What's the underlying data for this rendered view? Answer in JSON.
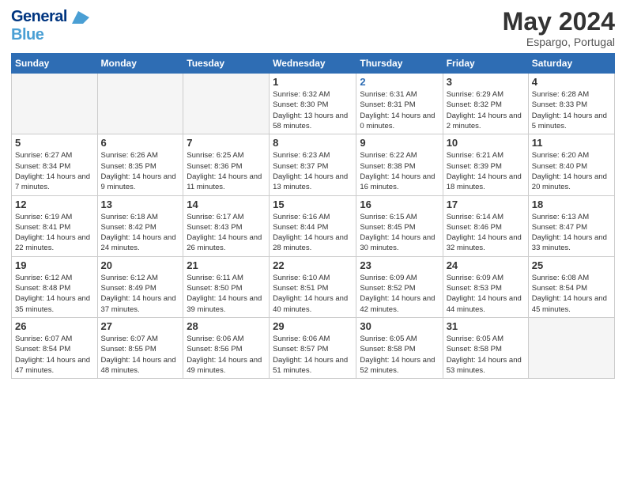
{
  "header": {
    "logo_line1": "General",
    "logo_line2": "Blue",
    "month": "May 2024",
    "location": "Espargo, Portugal"
  },
  "weekdays": [
    "Sunday",
    "Monday",
    "Tuesday",
    "Wednesday",
    "Thursday",
    "Friday",
    "Saturday"
  ],
  "weeks": [
    [
      {
        "day": "",
        "empty": true
      },
      {
        "day": "",
        "empty": true
      },
      {
        "day": "",
        "empty": true
      },
      {
        "day": "1",
        "sunrise": "6:32 AM",
        "sunset": "8:30 PM",
        "daylight": "13 hours and 58 minutes."
      },
      {
        "day": "2",
        "sunrise": "6:31 AM",
        "sunset": "8:31 PM",
        "daylight": "14 hours and 0 minutes.",
        "highlight": true
      },
      {
        "day": "3",
        "sunrise": "6:29 AM",
        "sunset": "8:32 PM",
        "daylight": "14 hours and 2 minutes."
      },
      {
        "day": "4",
        "sunrise": "6:28 AM",
        "sunset": "8:33 PM",
        "daylight": "14 hours and 5 minutes."
      }
    ],
    [
      {
        "day": "5",
        "sunrise": "6:27 AM",
        "sunset": "8:34 PM",
        "daylight": "14 hours and 7 minutes."
      },
      {
        "day": "6",
        "sunrise": "6:26 AM",
        "sunset": "8:35 PM",
        "daylight": "14 hours and 9 minutes."
      },
      {
        "day": "7",
        "sunrise": "6:25 AM",
        "sunset": "8:36 PM",
        "daylight": "14 hours and 11 minutes."
      },
      {
        "day": "8",
        "sunrise": "6:23 AM",
        "sunset": "8:37 PM",
        "daylight": "14 hours and 13 minutes."
      },
      {
        "day": "9",
        "sunrise": "6:22 AM",
        "sunset": "8:38 PM",
        "daylight": "14 hours and 16 minutes."
      },
      {
        "day": "10",
        "sunrise": "6:21 AM",
        "sunset": "8:39 PM",
        "daylight": "14 hours and 18 minutes."
      },
      {
        "day": "11",
        "sunrise": "6:20 AM",
        "sunset": "8:40 PM",
        "daylight": "14 hours and 20 minutes."
      }
    ],
    [
      {
        "day": "12",
        "sunrise": "6:19 AM",
        "sunset": "8:41 PM",
        "daylight": "14 hours and 22 minutes."
      },
      {
        "day": "13",
        "sunrise": "6:18 AM",
        "sunset": "8:42 PM",
        "daylight": "14 hours and 24 minutes."
      },
      {
        "day": "14",
        "sunrise": "6:17 AM",
        "sunset": "8:43 PM",
        "daylight": "14 hours and 26 minutes."
      },
      {
        "day": "15",
        "sunrise": "6:16 AM",
        "sunset": "8:44 PM",
        "daylight": "14 hours and 28 minutes."
      },
      {
        "day": "16",
        "sunrise": "6:15 AM",
        "sunset": "8:45 PM",
        "daylight": "14 hours and 30 minutes."
      },
      {
        "day": "17",
        "sunrise": "6:14 AM",
        "sunset": "8:46 PM",
        "daylight": "14 hours and 32 minutes."
      },
      {
        "day": "18",
        "sunrise": "6:13 AM",
        "sunset": "8:47 PM",
        "daylight": "14 hours and 33 minutes."
      }
    ],
    [
      {
        "day": "19",
        "sunrise": "6:12 AM",
        "sunset": "8:48 PM",
        "daylight": "14 hours and 35 minutes."
      },
      {
        "day": "20",
        "sunrise": "6:12 AM",
        "sunset": "8:49 PM",
        "daylight": "14 hours and 37 minutes."
      },
      {
        "day": "21",
        "sunrise": "6:11 AM",
        "sunset": "8:50 PM",
        "daylight": "14 hours and 39 minutes."
      },
      {
        "day": "22",
        "sunrise": "6:10 AM",
        "sunset": "8:51 PM",
        "daylight": "14 hours and 40 minutes."
      },
      {
        "day": "23",
        "sunrise": "6:09 AM",
        "sunset": "8:52 PM",
        "daylight": "14 hours and 42 minutes."
      },
      {
        "day": "24",
        "sunrise": "6:09 AM",
        "sunset": "8:53 PM",
        "daylight": "14 hours and 44 minutes."
      },
      {
        "day": "25",
        "sunrise": "6:08 AM",
        "sunset": "8:54 PM",
        "daylight": "14 hours and 45 minutes."
      }
    ],
    [
      {
        "day": "26",
        "sunrise": "6:07 AM",
        "sunset": "8:54 PM",
        "daylight": "14 hours and 47 minutes."
      },
      {
        "day": "27",
        "sunrise": "6:07 AM",
        "sunset": "8:55 PM",
        "daylight": "14 hours and 48 minutes."
      },
      {
        "day": "28",
        "sunrise": "6:06 AM",
        "sunset": "8:56 PM",
        "daylight": "14 hours and 49 minutes."
      },
      {
        "day": "29",
        "sunrise": "6:06 AM",
        "sunset": "8:57 PM",
        "daylight": "14 hours and 51 minutes."
      },
      {
        "day": "30",
        "sunrise": "6:05 AM",
        "sunset": "8:58 PM",
        "daylight": "14 hours and 52 minutes."
      },
      {
        "day": "31",
        "sunrise": "6:05 AM",
        "sunset": "8:58 PM",
        "daylight": "14 hours and 53 minutes."
      },
      {
        "day": "",
        "empty": true
      }
    ]
  ]
}
